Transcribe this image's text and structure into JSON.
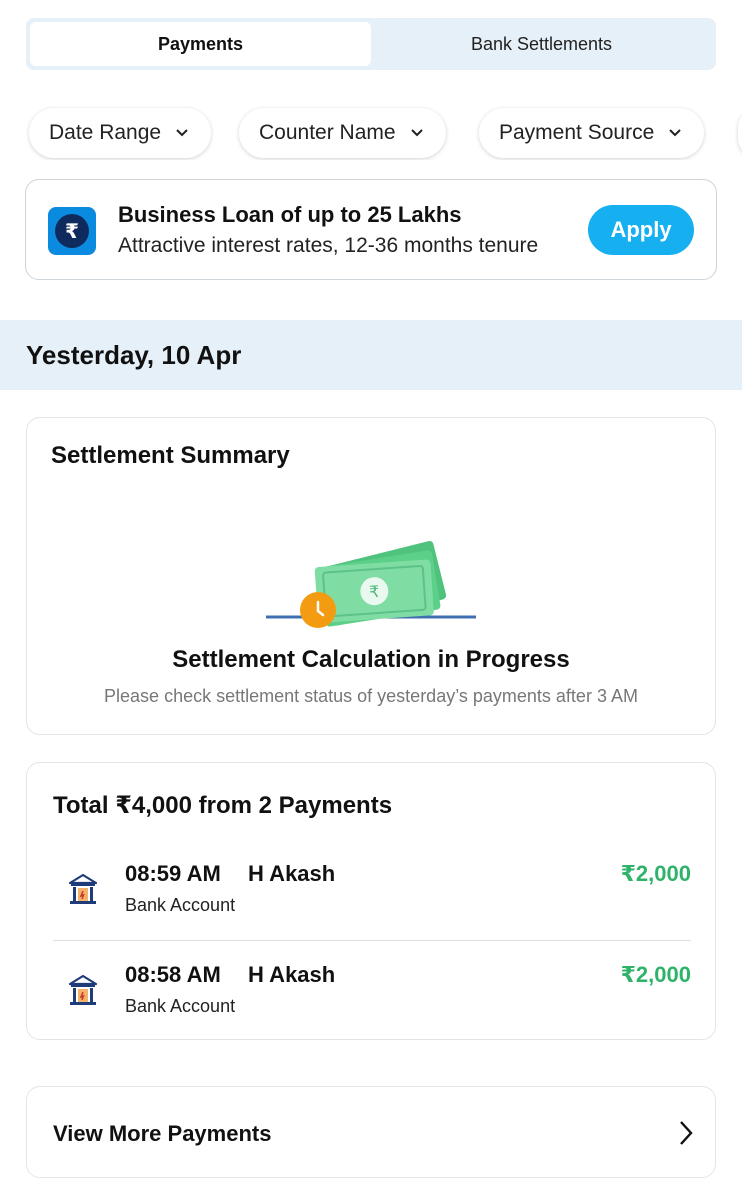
{
  "tabs": [
    {
      "label": "Payments",
      "active": true
    },
    {
      "label": "Bank Settlements",
      "active": false
    }
  ],
  "filters": [
    {
      "label": "Date Range"
    },
    {
      "label": "Counter Name"
    },
    {
      "label": "Payment Source"
    }
  ],
  "promo": {
    "title": "Business Loan of up to 25 Lakhs",
    "subtitle": "Attractive interest rates, 12-36 months tenure",
    "button": "Apply",
    "icon": "rupee-icon",
    "accent": "#16aff0"
  },
  "date_header": "Yesterday, 10 Apr",
  "settlement_summary": {
    "heading": "Settlement Summary",
    "illustration": "money-clock-illustration",
    "status_title": "Settlement Calculation in Progress",
    "status_message": "Please check settlement status of yesterday’s payments after 3 AM"
  },
  "payments": {
    "heading": "Total ₹4,000 from 2 Payments",
    "items": [
      {
        "time": "08:59 AM",
        "name": "H Akash",
        "method": "Bank Account",
        "amount": "₹2,000",
        "icon": "bank-icon"
      },
      {
        "time": "08:58 AM",
        "name": "H Akash",
        "method": "Bank Account",
        "amount": "₹2,000",
        "icon": "bank-icon"
      }
    ],
    "amount_color": "#2fb36a"
  },
  "view_more": {
    "label": "View More Payments",
    "icon": "chevron-right-icon"
  }
}
